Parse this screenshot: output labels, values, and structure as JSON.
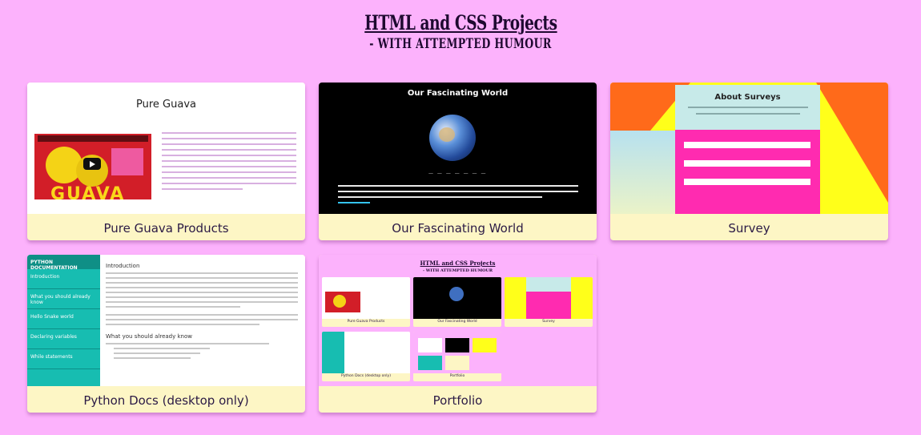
{
  "header": {
    "title": "HTML and CSS Projects",
    "subtitle": "- WITH ATTEMPTED HUMOUR"
  },
  "projects": [
    {
      "label": "Pure Guava Products",
      "thumb_text": "Pure Guava"
    },
    {
      "label": "Our Fascinating World",
      "thumb_text": "Our Fascinating World"
    },
    {
      "label": "Survey",
      "thumb_text": "About Surveys"
    },
    {
      "label": "Python Docs (desktop only)",
      "thumb_text": "PYTHON DOCUMENTATION"
    },
    {
      "label": "Portfolio",
      "thumb_text": "HTML and CSS Projects"
    }
  ],
  "python_nav": [
    "PYTHON DOCUMENTATION",
    "Introduction",
    "What you should already know",
    "Hello Snake world",
    "Declaring variables",
    "While statements"
  ],
  "python_main": {
    "heading_1": "Introduction",
    "heading_2": "What you should already know"
  },
  "portfolio_mini": {
    "title": "HTML and CSS Projects",
    "subtitle": "- WITH ATTEMPTED HUMOUR",
    "labels": [
      "Pure Guava Products",
      "Our Fascinating World",
      "Survey",
      "Python Docs (desktop only)",
      "Portfolio"
    ]
  },
  "colors": {
    "background": "#fcb2fc",
    "card_label_bg": "#fdf6c5",
    "text": "#2b1a45"
  }
}
